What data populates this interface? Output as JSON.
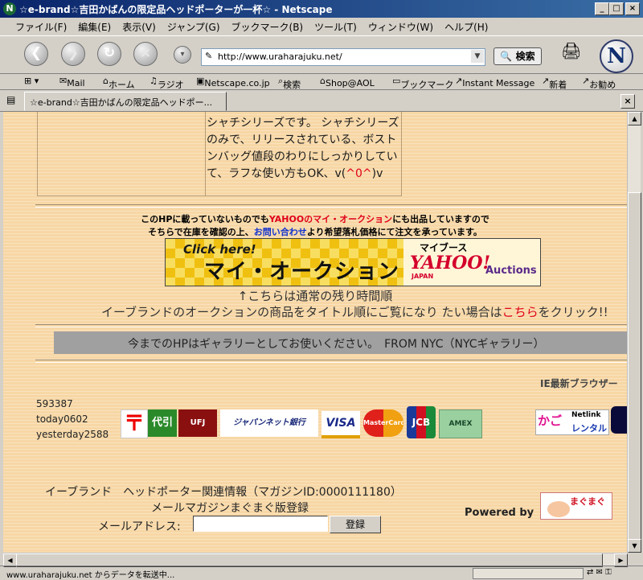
{
  "window": {
    "title": "☆e-brand☆吉田かばんの限定品ヘッドポーターが一杯☆ - Netscape",
    "menu": [
      "ファイル(F)",
      "編集(E)",
      "表示(V)",
      "ジャンプ(G)",
      "ブックマーク(B)",
      "ツール(T)",
      "ウィンドウ(W)",
      "ヘルプ(H)"
    ]
  },
  "navigation": {
    "url": "http://www.uraharajuku.net/",
    "search_label": "検索",
    "logo_letter": "N"
  },
  "personal_toolbar": [
    "Mail",
    "ホーム",
    "ラジオ",
    "Netscape.co.jp",
    "検索",
    "Shop@AOL",
    "ブックマーク",
    "Instant Message",
    "新着",
    "お勧め"
  ],
  "tab": {
    "label": "☆e-brand☆吉田かばんの限定品ヘッドポー..."
  },
  "page": {
    "product_description": "シャチシリーズです。 シャチシリーズのみで、リリースされている、ボストンバッグ値段のわりにしっかりしていて、ラフな使い方もOK、v(",
    "product_emote": "^0^",
    "product_description_tail": ")v",
    "notice_line1_a": "このHPに載っていないものでも",
    "notice_line1_link": "YAHOOのマイ・オークション",
    "notice_line1_b": "にも出品していますので",
    "notice_line2_a": "そちらで在庫を確認の上、",
    "notice_line2_link": "お問い合わせ",
    "notice_line2_b": "より希望落札価格にて注文を承っています。",
    "banner": {
      "click_here": "Click here!",
      "main_text": "マイ・オークション",
      "booth": "マイブース",
      "yahoo": "YAHOO!",
      "japan": "JAPAN",
      "auctions": "Auctions"
    },
    "arrow_text": "↑こちらは通常の残り時間順",
    "click_text_a": "イーブランドのオークションの商品をタイトル順にご覧になり たい場合は",
    "click_text_link": "こちら",
    "click_text_b": "をクリック!!",
    "gallery_text": "今までのHPはギャラリーとしてお使いください。　FROM NYC（NYCギャラリー）",
    "ie_notice": "IE最新ブラウザー",
    "counter": {
      "total": "593387",
      "today": "today0602",
      "yesterday": "yesterday2588"
    },
    "payment_logos": [
      "〒",
      "代引",
      "UFJ Card",
      "ジャパンネット銀行",
      "VISA",
      "MasterCard",
      "JCB",
      "AMEX"
    ],
    "rental_logo": {
      "a": "かご",
      "b": "Netlink",
      "c": "レンタル"
    },
    "magazine_title": "イーブランド　ヘッドポーター関連情報（マガジンID:0000111180）",
    "magazine_subtitle": "メールマガジンまぐまぐ版登録",
    "email_label": "メールアドレス:",
    "email_value": "",
    "register_button": "登録",
    "powered_by": "Powered by",
    "mag_logo": "まぐまぐ"
  },
  "status_text": "www.uraharajuku.net からデータを転送中..."
}
